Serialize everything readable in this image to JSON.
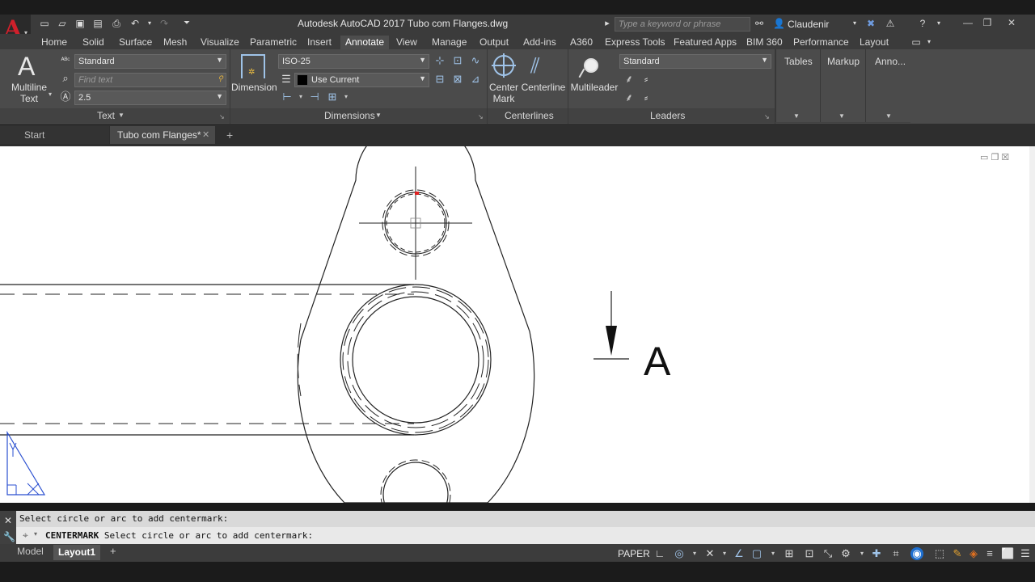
{
  "app": {
    "title": "Autodesk AutoCAD 2017   Tubo com Flanges.dwg",
    "search_placeholder": "Type a keyword or phrase",
    "user": "Claudenir"
  },
  "ribbon_tabs": [
    "Home",
    "Solid",
    "Surface",
    "Mesh",
    "Visualize",
    "Parametric",
    "Insert",
    "Annotate",
    "View",
    "Manage",
    "Output",
    "Add-ins",
    "A360",
    "Express Tools",
    "Featured Apps",
    "BIM 360",
    "Performance",
    "Layout"
  ],
  "active_tab": "Annotate",
  "text_panel": {
    "title": "Text",
    "multiline_line1": "Multiline",
    "multiline_line2": "Text",
    "style": "Standard",
    "find_placeholder": "Find text",
    "height": "2.5"
  },
  "dimensions_panel": {
    "title": "Dimensions",
    "dimension_label": "Dimension",
    "dimstyle": "ISO-25",
    "layer": "Use Current"
  },
  "centerlines_panel": {
    "title": "Centerlines",
    "center_mark_line1": "Center",
    "center_mark_line2": "Mark",
    "centerline_label": "Centerline"
  },
  "leaders_panel": {
    "title": "Leaders",
    "multileader_label": "Multileader",
    "style": "Standard"
  },
  "extra_panels": [
    "Tables",
    "Markup",
    "Anno..."
  ],
  "doc_tabs": {
    "start": "Start",
    "drawing": "Tubo com Flanges*"
  },
  "drawing": {
    "section_label": "A"
  },
  "command_line": {
    "history": "Select circle or arc to add centermark:",
    "command": "CENTERMARK",
    "prompt": "Select circle or arc to add centermark:"
  },
  "status_bar": {
    "model_tab": "Model",
    "layout_tab": "Layout1",
    "paper": "PAPER"
  },
  "colors": {
    "accent_red": "#d0202b",
    "ribbon_bg": "#4b4b4b",
    "canvas_bg": "#ffffff",
    "ucs_blue": "#2a4fd0"
  }
}
